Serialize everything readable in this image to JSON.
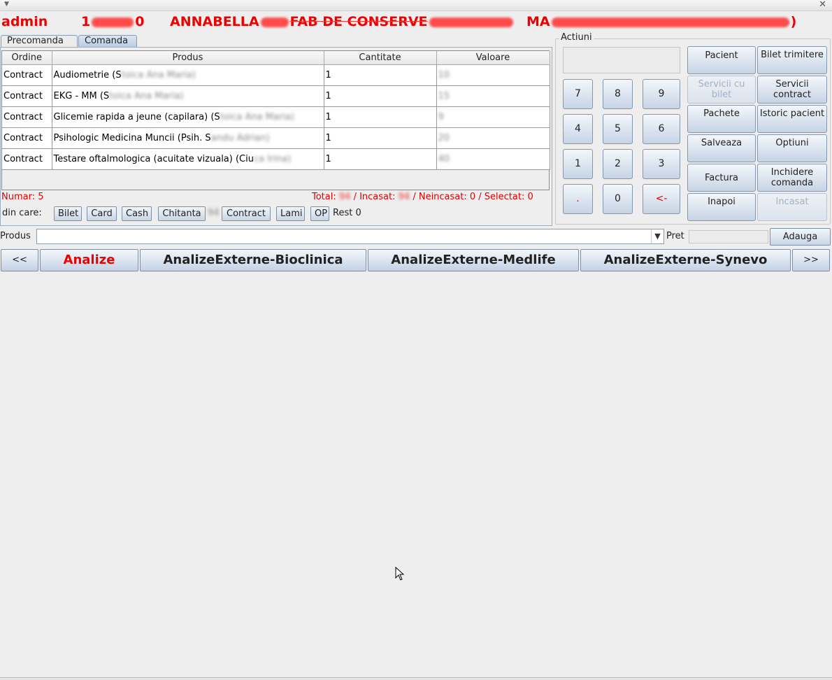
{
  "header": {
    "user": "admin",
    "code_visible": "1",
    "code_tail": "0",
    "company_start": "ANNABELLA",
    "company_visible": "FAB DE CONSERVE",
    "patient_start": "MA",
    "patient_close": ")"
  },
  "tabs": [
    {
      "label": "Precomanda",
      "active": false
    },
    {
      "label": "Comanda",
      "active": true
    }
  ],
  "table": {
    "columns": [
      "Ordine",
      "Produs",
      "Cantitate",
      "Valoare"
    ],
    "rows": [
      {
        "ordine": "Contract",
        "produs": "Audiometrie (S",
        "doctor": "toica Ana Maria)",
        "cantitate": "1",
        "valoare": "10"
      },
      {
        "ordine": "Contract",
        "produs": "EKG - MM (S",
        "doctor": "toica Ana Maria)",
        "cantitate": "1",
        "valoare": "15"
      },
      {
        "ordine": "Contract",
        "produs": "Glicemie rapida a jeune (capilara) (S",
        "doctor": "toica Ana Maria)",
        "cantitate": "1",
        "valoare": "9"
      },
      {
        "ordine": "Contract",
        "produs": "Psihologic Medicina Muncii (Psih. S",
        "doctor": "andu Adrian)",
        "cantitate": "1",
        "valoare": "20"
      },
      {
        "ordine": "Contract",
        "produs": "Testare oftalmologica (acuitate vizuala) (Ciu",
        "doctor": "ca Irina)",
        "cantitate": "1",
        "valoare": "40"
      }
    ]
  },
  "summary": {
    "numar": "Numar: 5",
    "total_label": "Total:",
    "total_value": "94",
    "incasat_label": "/ Incasat:",
    "incasat_value": "94",
    "rest": "/ Neincasat: 0 / Selectat: 0"
  },
  "payment": {
    "din_care": "din care:",
    "buttons": [
      "Bilet",
      "Card",
      "Cash",
      "Chitanta",
      "Contract",
      "Lami",
      "OP"
    ],
    "chitanta_amount": "94",
    "rest": "Rest 0"
  },
  "actions": {
    "title": "Actiuni",
    "keypad": [
      "7",
      "8",
      "9",
      "4",
      "5",
      "6",
      "1",
      "2",
      "3",
      ".",
      "0",
      "<-"
    ],
    "buttons": [
      {
        "label": "Pacient",
        "enabled": true
      },
      {
        "label": "Bilet trimitere",
        "enabled": true
      },
      {
        "label": "Servicii cu bilet",
        "enabled": false
      },
      {
        "label": "Servicii contract",
        "enabled": true
      },
      {
        "label": "Pachete",
        "enabled": true
      },
      {
        "label": "Istoric pacient",
        "enabled": true
      },
      {
        "label": "Salveaza",
        "enabled": true
      },
      {
        "label": "Optiuni",
        "enabled": true
      },
      {
        "label": "Factura",
        "enabled": true
      },
      {
        "label": "Inchidere comanda",
        "enabled": true
      },
      {
        "label": "Inapoi",
        "enabled": true
      },
      {
        "label": "Incasat",
        "enabled": false
      }
    ]
  },
  "product_bar": {
    "produs_label": "Produs",
    "produs_value": "",
    "pret_label": "Pret",
    "adauga": "Adauga"
  },
  "categories": {
    "prev": "<<",
    "items": [
      "Analize",
      "AnalizeExterne-Bioclinica",
      "AnalizeExterne-Medlife",
      "AnalizeExterne-Synevo"
    ],
    "selected": "Analize",
    "next": ">>"
  },
  "colors": {
    "accent_red": "#ee0000",
    "button_blue": "#c6d4e5"
  }
}
